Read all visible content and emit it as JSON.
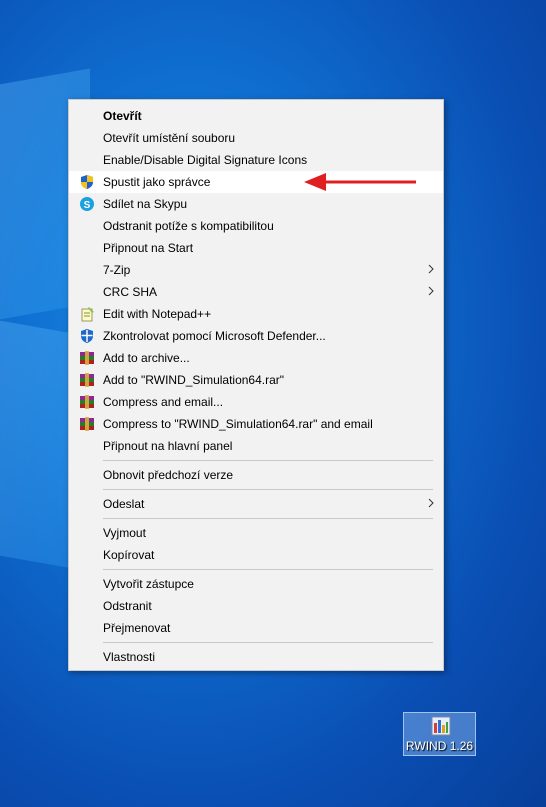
{
  "menu": {
    "items": [
      {
        "label": "Otevřít",
        "bold": true,
        "icon": null,
        "submenu": false
      },
      {
        "label": "Otevřít umístění souboru",
        "icon": null,
        "submenu": false
      },
      {
        "label": "Enable/Disable Digital Signature Icons",
        "icon": null,
        "submenu": false
      },
      {
        "label": "Spustit jako správce",
        "icon": "uac-shield-icon",
        "submenu": false,
        "highlighted": true
      },
      {
        "label": "Sdílet na Skypu",
        "icon": "skype-icon",
        "submenu": false
      },
      {
        "label": "Odstranit potíže s kompatibilitou",
        "icon": null,
        "submenu": false
      },
      {
        "label": "Připnout na Start",
        "icon": null,
        "submenu": false
      },
      {
        "label": "7-Zip",
        "icon": null,
        "submenu": true
      },
      {
        "label": "CRC SHA",
        "icon": null,
        "submenu": true
      },
      {
        "label": "Edit with Notepad++",
        "icon": "notepad-plus-plus-icon",
        "submenu": false
      },
      {
        "label": "Zkontrolovat pomocí Microsoft Defender...",
        "icon": "defender-icon",
        "submenu": false
      },
      {
        "label": "Add to archive...",
        "icon": "winrar-icon",
        "submenu": false
      },
      {
        "label": "Add to \"RWIND_Simulation64.rar\"",
        "icon": "winrar-icon",
        "submenu": false
      },
      {
        "label": "Compress and email...",
        "icon": "winrar-icon",
        "submenu": false
      },
      {
        "label": "Compress to \"RWIND_Simulation64.rar\" and email",
        "icon": "winrar-icon",
        "submenu": false
      },
      {
        "label": "Připnout na hlavní panel",
        "icon": null,
        "submenu": false
      },
      {
        "label": "Obnovit předchozí verze",
        "icon": null,
        "submenu": false
      },
      {
        "label": "Odeslat",
        "icon": null,
        "submenu": true
      },
      {
        "label": "Vyjmout",
        "icon": null,
        "submenu": false
      },
      {
        "label": "Kopírovat",
        "icon": null,
        "submenu": false
      },
      {
        "label": "Vytvořit zástupce",
        "icon": null,
        "submenu": false
      },
      {
        "label": "Odstranit",
        "icon": null,
        "submenu": false
      },
      {
        "label": "Přejmenovat",
        "icon": null,
        "submenu": false
      },
      {
        "label": "Vlastnosti",
        "icon": null,
        "submenu": false
      }
    ]
  },
  "annotation": {
    "icon": "red-arrow-icon",
    "color": "#e02020"
  },
  "desktop_icon": {
    "label": "RWIND 1.26",
    "icon": "rwind-app-icon"
  },
  "colors": {
    "menu_bg": "#f2f2f2",
    "highlight": "#ffffff",
    "desktop": "#0f6fd0"
  }
}
